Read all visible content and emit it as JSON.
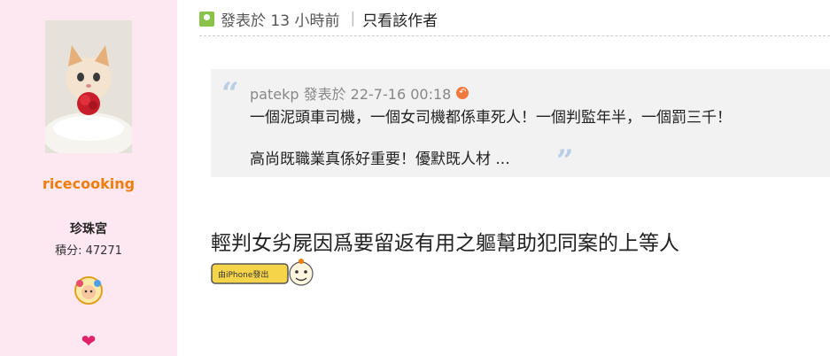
{
  "sidebar": {
    "username": "ricecooking",
    "group": "珍珠宮",
    "points": "積分: 47271",
    "avatar_icon": "kitten-with-rose-avatar",
    "medal_icon": "2021-medal-icon",
    "heart_icon": "heart-icon"
  },
  "postbar": {
    "posted": "發表於 13 小時前",
    "only_author": "只看該作者"
  },
  "quote": {
    "author_time": "patekp 發表於 22-7-16 00:18",
    "line1": "一個泥頭車司機，一個女司機都係車死人！一個判監年半，一個罰三千！",
    "line2": "高尚既職業真係好重要！優默既人材 ..."
  },
  "message": "輕判女劣屍因爲要留返有用之軀幫助犯同案的上等人",
  "badge": {
    "label": "由iPhone發出"
  }
}
